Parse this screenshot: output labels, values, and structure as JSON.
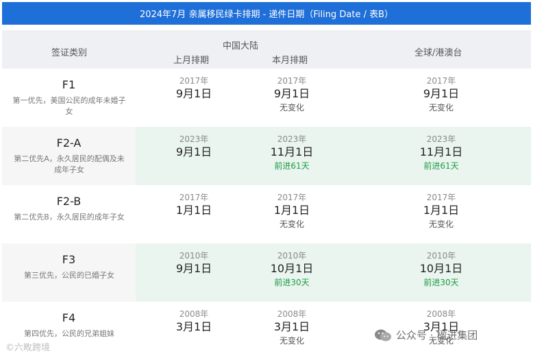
{
  "banner": {
    "title": "2024年7月 亲属移民绿卡排期 - 递件日期（Filing Date / 表B）"
  },
  "header": {
    "visa_category": "签证类别",
    "china_mainland": "中国大陆",
    "last_month": "上月排期",
    "this_month": "本月排期",
    "global": "全球/港澳台"
  },
  "rows": [
    {
      "code": "F1",
      "desc": "第一优先，美国公民的成年未婚子女",
      "last": {
        "year": "2017年",
        "date": "9月1日"
      },
      "this": {
        "year": "2017年",
        "date": "9月1日",
        "change": "无变化"
      },
      "global": {
        "year": "2017年",
        "date": "9月1日",
        "change": "无变化"
      }
    },
    {
      "code": "F2-A",
      "desc": "第二优先A，永久居民的配偶及未成年子女",
      "last": {
        "year": "2023年",
        "date": "9月1日"
      },
      "this": {
        "year": "2023年",
        "date": "11月1日",
        "change": "前进61天"
      },
      "global": {
        "year": "2023年",
        "date": "11月1日",
        "change": "前进61天"
      }
    },
    {
      "code": "F2-B",
      "desc": "第二优先B，永久居民的成年子女",
      "last": {
        "year": "2017年",
        "date": "1月1日"
      },
      "this": {
        "year": "2017年",
        "date": "1月1日",
        "change": "无变化"
      },
      "global": {
        "year": "2017年",
        "date": "1月1日",
        "change": "无变化"
      }
    },
    {
      "code": "F3",
      "desc": "第三优先，公民的已婚子女",
      "last": {
        "year": "2010年",
        "date": "9月1日"
      },
      "this": {
        "year": "2010年",
        "date": "10月1日",
        "change": "前进30天"
      },
      "global": {
        "year": "2010年",
        "date": "10月1日",
        "change": "前进30天"
      }
    },
    {
      "code": "F4",
      "desc": "第四优先，公民的兄弟姐妹",
      "last": {
        "year": "2008年",
        "date": "3月1日"
      },
      "this": {
        "year": "2008年",
        "date": "3月1日",
        "change": "无变化"
      },
      "global": {
        "year": "2008年",
        "date": "3月1日",
        "change": "无变化"
      }
    }
  ],
  "watermarks": {
    "left": "©六畋跨境",
    "right": "公众号 · 楹进集团",
    "right_icon": "wechat-icon"
  },
  "colors": {
    "banner": "#1f6fd8",
    "header_bg": "#eef0f3",
    "shade_bg": "#e9f5ee",
    "advance_text": "#1f9a48"
  }
}
